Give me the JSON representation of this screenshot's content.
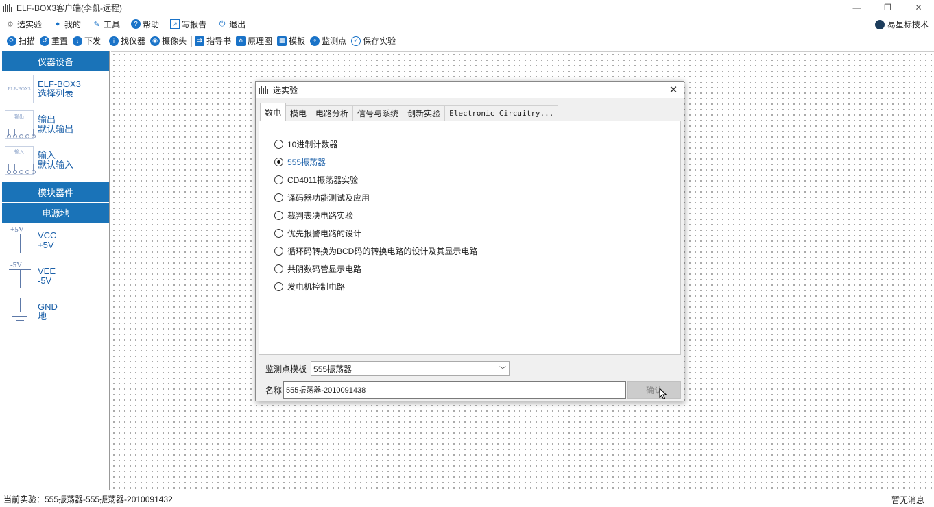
{
  "window": {
    "title": "ELF-BOX3客户端(李凯-远程)",
    "controls": [
      "—",
      "❐",
      "✕"
    ]
  },
  "menu": {
    "items": [
      {
        "label": "选实验",
        "icon": "select-icon"
      },
      {
        "label": "我的",
        "icon": "user-icon"
      },
      {
        "label": "工具",
        "icon": "wrench-icon"
      },
      {
        "label": "帮助",
        "icon": "help-icon"
      },
      {
        "label": "写报告",
        "icon": "report-icon"
      },
      {
        "label": "退出",
        "icon": "power-icon"
      }
    ],
    "brand": "易星标技术"
  },
  "toolbar": {
    "items": [
      {
        "label": "扫描",
        "icon": "scan-icon"
      },
      {
        "label": "重置",
        "icon": "reset-icon"
      },
      {
        "label": "下发",
        "icon": "download-icon"
      },
      {
        "label": "找仪器",
        "icon": "info-icon"
      },
      {
        "label": "摄像头",
        "icon": "camera-icon"
      },
      {
        "label": "指导书",
        "icon": "guide-icon"
      },
      {
        "label": "原理图",
        "icon": "schematic-icon"
      },
      {
        "label": "模板",
        "icon": "template-icon"
      },
      {
        "label": "监测点",
        "icon": "pin-icon"
      },
      {
        "label": "保存实验",
        "icon": "save-icon"
      }
    ]
  },
  "sidebar": {
    "sections": {
      "instruments": "仪器设备",
      "modules": "模块器件",
      "power": "电源地"
    },
    "instruments": [
      {
        "thumb": "ELF-BOX3",
        "line1": "ELF-BOX3",
        "line2": "选择列表"
      },
      {
        "thumb": "输出",
        "line1": "输出",
        "line2": "默认输出"
      },
      {
        "thumb": "输入",
        "line1": "输入",
        "line2": "默认输入"
      }
    ],
    "power": [
      {
        "symbol": "+5V",
        "line1": "VCC",
        "line2": "+5V"
      },
      {
        "symbol": "-5V",
        "line1": "VEE",
        "line2": "-5V"
      },
      {
        "symbol": "",
        "line1": "GND",
        "line2": "地"
      }
    ]
  },
  "dialog": {
    "title": "选实验",
    "tabs": [
      "数电",
      "模电",
      "电路分析",
      "信号与系统",
      "创新实验",
      "Electronic Circuitry..."
    ],
    "active_tab": "数电",
    "options": [
      "10进制计数器",
      "555振荡器",
      "CD4011振荡器实验",
      "译码器功能测试及应用",
      "裁判表决电路实验",
      "优先报警电路的设计",
      "循环码转换为BCD码的转换电路的设计及其显示电路",
      "共阴数码管显示电路",
      "发电机控制电路"
    ],
    "selected": "555振荡器",
    "template_label": "监测点模板",
    "template_value": "555振荡器",
    "name_label": "名称",
    "name_value": "555振荡器-2010091438",
    "ok_label": "确认"
  },
  "status": {
    "current": "当前实验：555振荡器-555振荡器-2010091432",
    "message": "暂无消息"
  }
}
